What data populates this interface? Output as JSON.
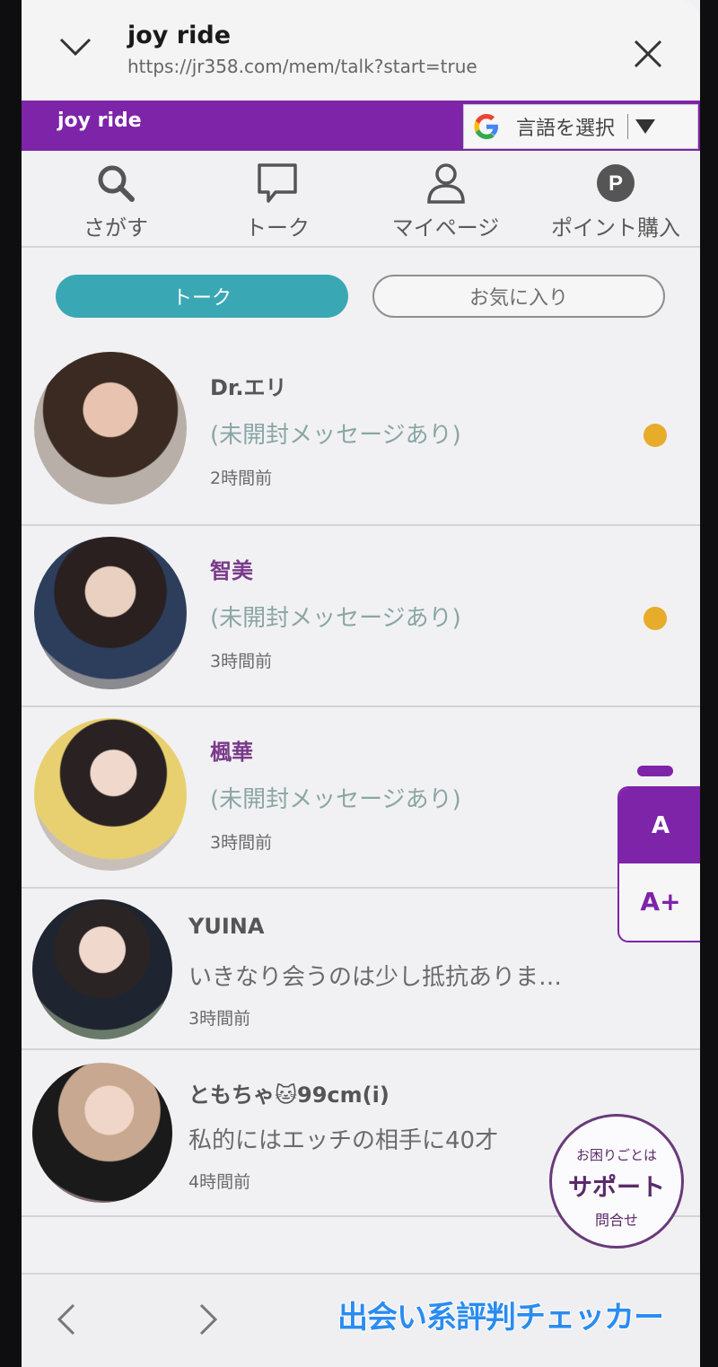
{
  "window": {
    "title": "joy ride",
    "url": "https://jr358.com/mem/talk?start=true"
  },
  "brandbar": {
    "brand": "joy ride",
    "translate_label": "言語を選択"
  },
  "nav": [
    {
      "label": "さがす",
      "icon": "search-icon"
    },
    {
      "label": "トーク",
      "icon": "chat-bubble-icon"
    },
    {
      "label": "マイページ",
      "icon": "person-icon"
    },
    {
      "label": "ポイント購入",
      "icon": "points-p-icon"
    }
  ],
  "tabs": {
    "talk": "トーク",
    "favorites": "お気に入り"
  },
  "talks": [
    {
      "name": "Dr.エリ",
      "message": "(未開封メッセージあり)",
      "time": "2時間前",
      "unread": true
    },
    {
      "name": "智美",
      "message": "(未開封メッセージあり)",
      "time": "3時間前",
      "unread": true
    },
    {
      "name": "楓華",
      "message": "(未開封メッセージあり)",
      "time": "3時間前",
      "unread": false
    },
    {
      "name": "YUINA",
      "message": "いきなり会うのは少し抵抗ありま…",
      "time": "3時間前",
      "unread": false
    },
    {
      "name": "ともちゃ🐱99cm(i)",
      "message": "私的にはエッチの相手に40才",
      "time": "4時間前",
      "unread": false
    }
  ],
  "font_control": {
    "normal": "A",
    "large": "A+"
  },
  "support": {
    "line1": "お困りごとは",
    "line2": "サポート",
    "line3": "問合せ"
  },
  "watermark": "出会い系評判チェッカー",
  "colors": {
    "brand_purple": "#7e24a8",
    "tab_active": "#3aa8b4",
    "unread_dot": "#e6ac2a",
    "unread_text": "#8aa6a4",
    "name_purple": "#7a3a8a"
  }
}
